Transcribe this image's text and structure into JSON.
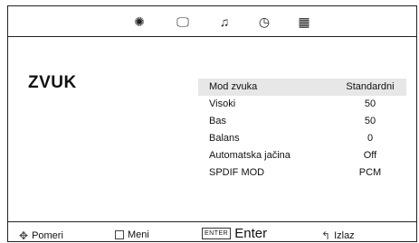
{
  "top_tabs": [
    {
      "icon": "picture-icon",
      "glyph": "✺"
    },
    {
      "icon": "monitor-icon",
      "glyph": "🖵"
    },
    {
      "icon": "music-note-icon",
      "glyph": "♫"
    },
    {
      "icon": "clock-icon",
      "glyph": "◷"
    },
    {
      "icon": "grid-icon",
      "glyph": "▦"
    }
  ],
  "page": {
    "title": "ZVUK"
  },
  "settings": [
    {
      "label": "Mod zvuka",
      "value": "Standardni",
      "selected": true
    },
    {
      "label": "Visoki",
      "value": "50"
    },
    {
      "label": "Bas",
      "value": "50"
    },
    {
      "label": "Balans",
      "value": "0"
    },
    {
      "label": "Automatska jačina",
      "value": "Off"
    },
    {
      "label": "SPDIF MOD",
      "value": "PCM"
    }
  ],
  "footer": {
    "move_label": "Pomeri",
    "menu_label": "Meni",
    "enter_key": "ENTER",
    "enter_label": "Enter",
    "exit_label": "Izlaz"
  }
}
